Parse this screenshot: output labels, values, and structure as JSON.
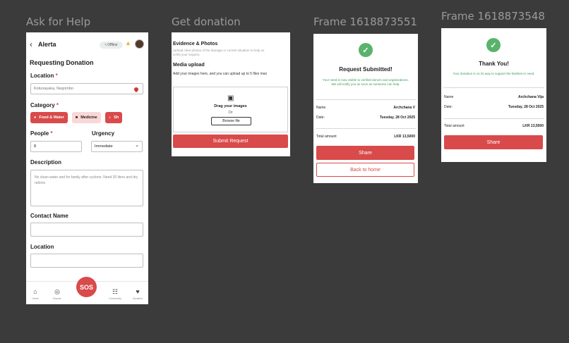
{
  "labels": {
    "frame1": "Ask for Help",
    "frame2": "Get donation",
    "frame3": "Frame 1618873551",
    "frame4": "Frame 1618873548"
  },
  "ask": {
    "brand": "Alerta",
    "status": "Offline",
    "title": "Requesting Donation",
    "location_label": "Location",
    "location_value": "Kotunayaka, Negombo",
    "category_label": "Category",
    "categories": [
      "Food & Water",
      "Medicine",
      "Sh"
    ],
    "people_label": "People",
    "people_value": "8",
    "urgency_label": "Urgency",
    "urgency_value": "Immediate",
    "description_label": "Description",
    "description_value": "No clean water and for family after cyclone. Need 20 liters and dry rations",
    "contact_label": "Contact Name",
    "location2_label": "Location",
    "tabs": [
      "Home",
      "Explore",
      "SOS",
      "Community",
      "Donation"
    ],
    "required_mark": "*"
  },
  "donation": {
    "evidence_title": "Evidence & Photos",
    "evidence_sub": "Upload clear photos of the damage or current situation to help us verify your request.",
    "media_title": "Media upload",
    "media_sub": "Add your images here, and you can upload up to 5 files max",
    "drag_text": "Drag your images",
    "or_text": "Or",
    "browse_label": "Browse file",
    "submit_label": "Submit Request"
  },
  "submitted": {
    "title": "Request Submitted!",
    "subtitle": "Your need is now visible to verified donors and organizations. We will notify you as soon as someone can help.",
    "name_key": "Name",
    "name_value": "Archchana V",
    "date_key": "Date:",
    "date_value": "Tuesday, 28 Oct 2025",
    "total_key": "Total amount",
    "total_value": "LKR 13,5000",
    "share_label": "Share",
    "back_label": "Back to home"
  },
  "thanks": {
    "title": "Thank You!",
    "subtitle": "Your donation is on its way to support the families in need.",
    "name_key": "Name",
    "name_value": "Archchana Vija",
    "date_key": "Date:",
    "date_value": "Tuesday, 28 Oct 2025",
    "total_key": "Total amount",
    "total_value": "LKR 13,5000",
    "share_label": "Share"
  },
  "colors": {
    "accent": "#d94a4a",
    "success": "#5ab36b",
    "canvas": "#3b3b3b"
  }
}
